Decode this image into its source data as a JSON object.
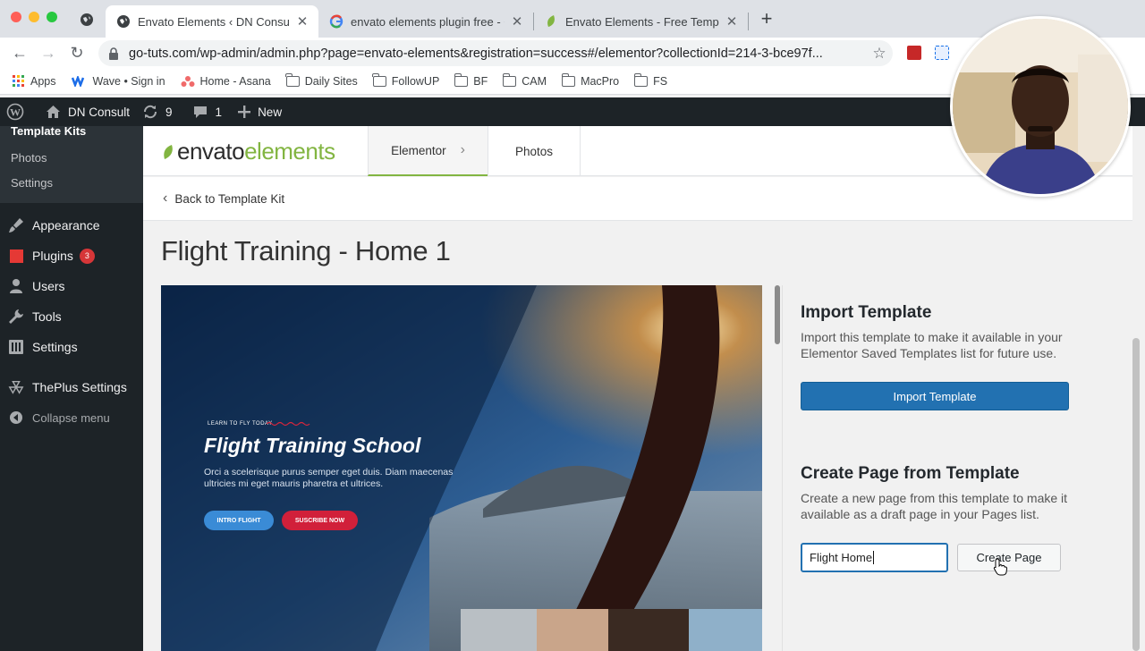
{
  "browser": {
    "tabs": [
      {
        "title": "Envato Elements ‹ DN Consult",
        "active": true,
        "favicon": "globe-icon"
      },
      {
        "title": "envato elements plugin free - G",
        "active": false,
        "favicon": "google-icon"
      },
      {
        "title": "Envato Elements - Free Templa",
        "active": false,
        "favicon": "envato-leaf-icon"
      }
    ],
    "url": "go-tuts.com/wp-admin/admin.php?page=envato-elements&registration=success#/elementor?collectionId=214-3-bce97f...",
    "bookmarks": [
      {
        "label": "Apps",
        "icon": "apps-grid-icon"
      },
      {
        "label": "Wave • Sign in",
        "icon": "wave-icon"
      },
      {
        "label": "Home - Asana",
        "icon": "asana-icon"
      },
      {
        "label": "Daily Sites",
        "icon": "folder-icon"
      },
      {
        "label": "FollowUP",
        "icon": "folder-icon"
      },
      {
        "label": "BF",
        "icon": "folder-icon"
      },
      {
        "label": "CAM",
        "icon": "folder-icon"
      },
      {
        "label": "MacPro",
        "icon": "folder-icon"
      },
      {
        "label": "FS",
        "icon": "folder-icon"
      }
    ]
  },
  "adminbar": {
    "site_name": "DN Consult",
    "updates_count": "9",
    "comments_count": "1",
    "new_label": "New"
  },
  "sidebar": {
    "submenu": [
      {
        "label": "Template Kits",
        "current": true
      },
      {
        "label": "Photos",
        "current": false
      },
      {
        "label": "Settings",
        "current": false
      }
    ],
    "items": [
      {
        "label": "Appearance",
        "icon": "paintbrush-icon"
      },
      {
        "label": "Plugins",
        "icon": "plugin-icon",
        "badge": "3"
      },
      {
        "label": "Users",
        "icon": "user-icon"
      },
      {
        "label": "Tools",
        "icon": "wrench-icon"
      },
      {
        "label": "Settings",
        "icon": "settings-icon"
      },
      {
        "label": "ThePlus Settings",
        "icon": "theplus-icon"
      }
    ],
    "collapse_label": "Collapse menu"
  },
  "envato": {
    "logo_dark": "envato",
    "logo_green": "elements",
    "tabs": [
      {
        "label": "Elementor",
        "active": true
      },
      {
        "label": "Photos",
        "active": false
      }
    ],
    "back_label": "Back to Template Kit",
    "page_title": "Flight Training - Home 1",
    "preview": {
      "eyebrow": "LEARN TO FLY TODAY",
      "headline": "Flight Training School",
      "body": "Orci a scelerisque purus semper eget duis. Diam maecenas ultricies mi eget mauris pharetra et ultrices.",
      "btn_intro": "INTRO FLIGHT",
      "btn_subscribe": "SUSCRIBE NOW"
    },
    "import_section": {
      "title": "Import Template",
      "description": "Import this template to make it available in your Elementor Saved Templates list for future use.",
      "button": "Import Template"
    },
    "create_section": {
      "title": "Create Page from Template",
      "description": "Create a new page from this template to make it available as a draft page in your Pages list.",
      "input_value": "Flight Home",
      "button": "Create Page"
    }
  },
  "colors": {
    "wp_dark": "#1d2327",
    "wp_blue": "#2271b1",
    "envato_green": "#82b541"
  }
}
